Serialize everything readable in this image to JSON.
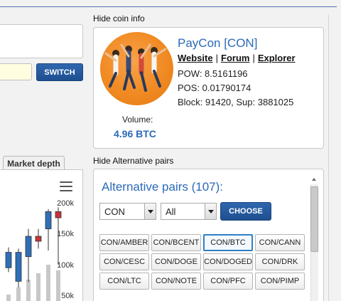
{
  "colors": {
    "accent": "#2a6ab8",
    "button": "#1e4f90",
    "candle_up": "#2f6fb8",
    "candle_down": "#c8323c",
    "volume": "#c8c8c8"
  },
  "left": {
    "switch_label": "SWITCH",
    "market_depth_tab": "Market depth",
    "chart_menu_icon": "hamburger-icon"
  },
  "coin_info": {
    "toggle_label": "Hide coin info",
    "name": "PayCon [CON]",
    "links": {
      "website": "Website",
      "forum": "Forum",
      "explorer": "Explorer",
      "separator": "|"
    },
    "pow": "POW: 8.5161196",
    "pos": "POS: 0.01790174",
    "block": "Block: 91420, Sup: 3881025",
    "volume_label": "Volume:",
    "volume_value": "4.96 BTC",
    "logo_icon": "paycon-logo-icon"
  },
  "alt_pairs": {
    "toggle_label": "Hide Alternative pairs",
    "title": "Alternative pairs (107):",
    "select_coin": "CON",
    "select_market": "All",
    "choose_label": "CHOOSE",
    "pairs": [
      "CON/AMBER",
      "CON/BCENT",
      "CON/BTC",
      "CON/CANN",
      "CON/CESC",
      "CON/DOGE",
      "CON/DOGED",
      "CON/DRK",
      "CON/LTC",
      "CON/NOTE",
      "CON/PFC",
      "CON/PIMP"
    ],
    "active_pair": "CON/BTC"
  },
  "chart_data": {
    "type": "candlestick",
    "y_ticks": [
      "200k",
      "150k",
      "100k",
      "50k"
    ],
    "ylim": [
      50000,
      200000
    ],
    "candles": [
      {
        "open": 97000,
        "close": 122000,
        "low": 90000,
        "high": 130000,
        "volume": 0.15
      },
      {
        "open": 75000,
        "close": 122000,
        "low": 65000,
        "high": 128000,
        "volume": 0.32
      },
      {
        "open": 115000,
        "close": 148000,
        "low": 74000,
        "high": 160000,
        "volume": 0.5
      },
      {
        "open": 148000,
        "close": 140000,
        "low": 128000,
        "high": 160000,
        "volume": 0.65
      },
      {
        "open": 160000,
        "close": 188000,
        "low": 125000,
        "high": 192000,
        "volume": 0.85
      },
      {
        "open": 188000,
        "close": 178000,
        "low": 102000,
        "high": 195000,
        "volume": 0.72
      }
    ]
  }
}
